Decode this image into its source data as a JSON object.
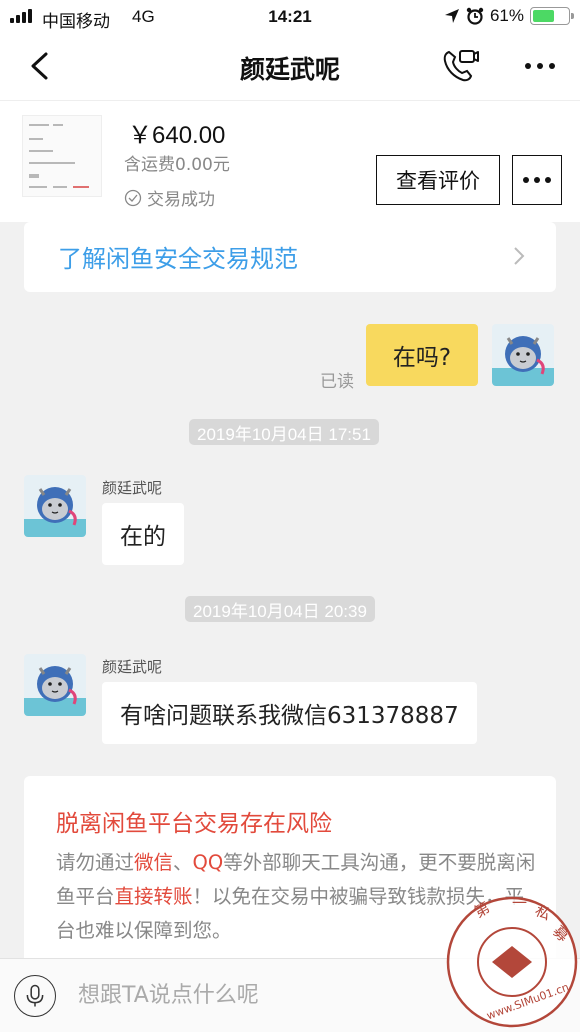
{
  "status_bar": {
    "carrier": "中国移动",
    "network": "4G",
    "time": "14:21",
    "battery": "61%",
    "battery_level": 0.61,
    "icons": [
      "signal-bars-icon",
      "location-arrow-icon",
      "alarm-clock-icon",
      "battery-icon"
    ]
  },
  "nav": {
    "title": "颜廷武呢",
    "icons": [
      "back-chevron-icon",
      "video-call-icon",
      "more-dots-icon"
    ]
  },
  "product": {
    "price": "￥640.00",
    "shipping": "含运费0.00元",
    "status": "交易成功",
    "review_button": "查看评价"
  },
  "safety_link": {
    "text": "了解闲鱼安全交易规范"
  },
  "messages": [
    {
      "direction": "out",
      "text": "在吗?",
      "read_status": "已读"
    },
    {
      "timestamp": "2019年10月04日  17:51"
    },
    {
      "direction": "in",
      "sender": "颜廷武呢",
      "text": "在的"
    },
    {
      "timestamp": "2019年10月04日  20:39"
    },
    {
      "direction": "in",
      "sender": "颜廷武呢",
      "text": "有啥问题联系我微信631378887"
    }
  ],
  "warning": {
    "title": "脱离闲鱼平台交易存在风险",
    "body_1": "请勿通过",
    "body_red_1": "微信",
    "body_2": "、",
    "body_red_2": "QQ",
    "body_3": "等外部聊天工具沟通，更不要脱离闲鱼平台",
    "body_red_3": "直接转账",
    "body_4": "！以免在交易中被骗导致钱款损失，平台也难以保障到您。"
  },
  "input": {
    "placeholder": "想跟TA说点什么呢"
  },
  "watermark": {
    "text": "第一私募",
    "url_text": "www.SIMu01.cn"
  },
  "colors": {
    "accent_yellow": "#f8d95e",
    "link_blue": "#3d9ee8",
    "warning_red": "#e24a3c",
    "battery_green": "#4cd964"
  }
}
